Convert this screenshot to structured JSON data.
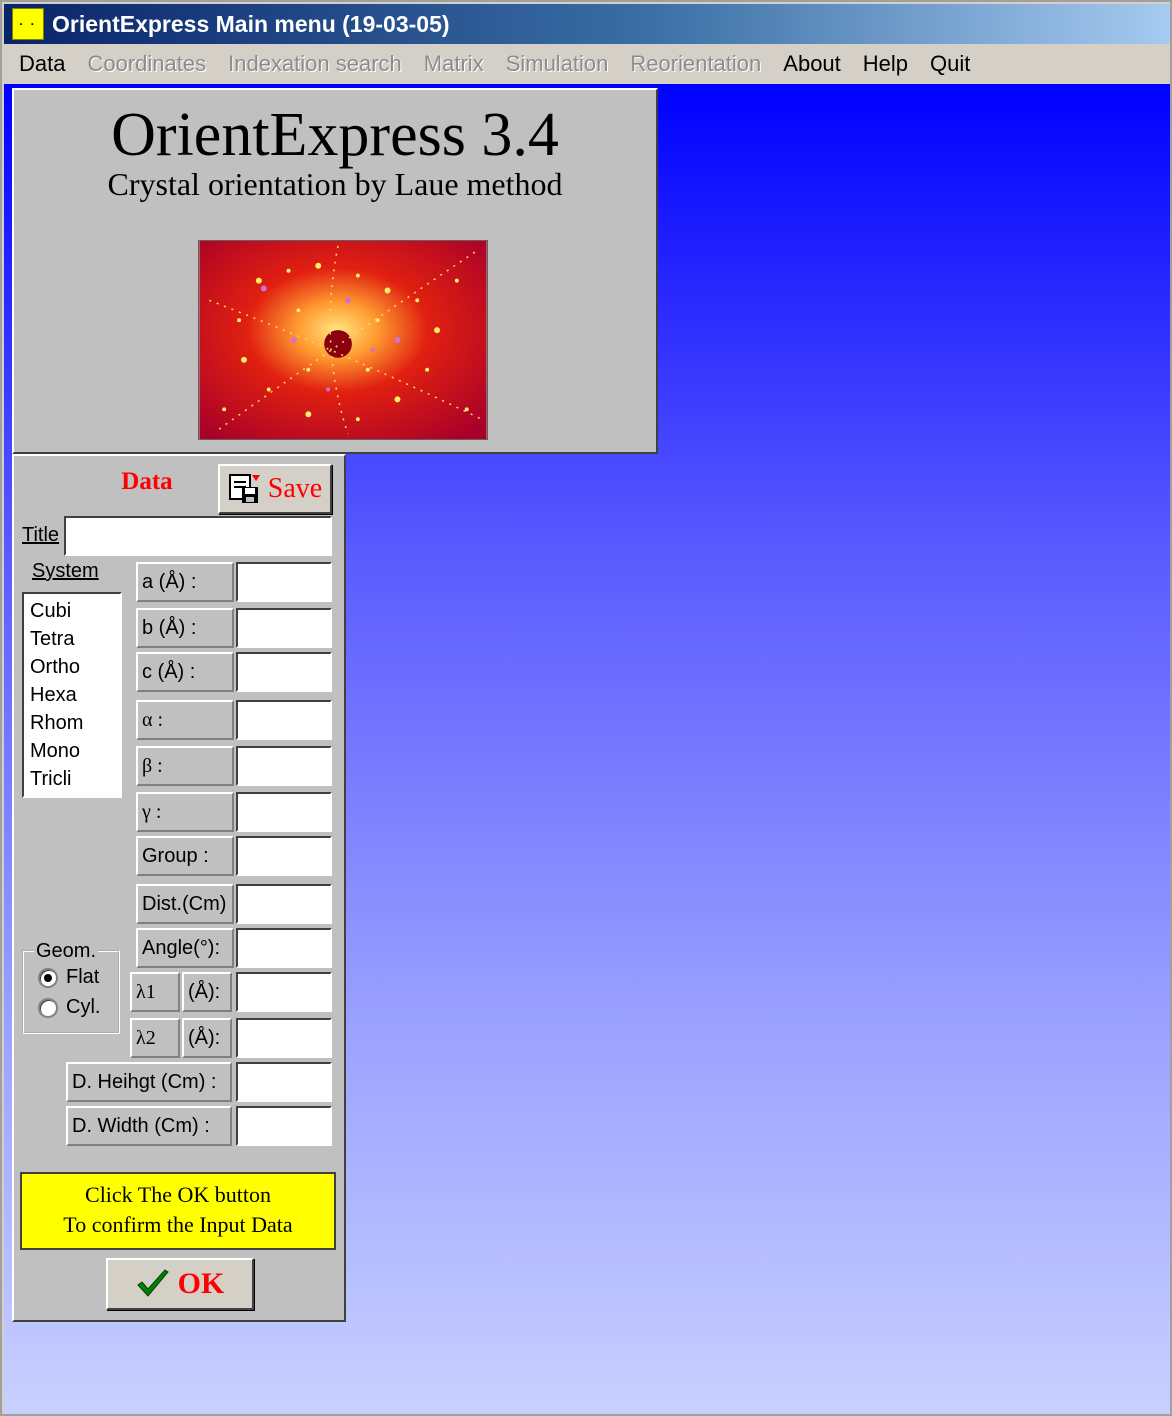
{
  "window": {
    "title": "OrientExpress Main menu (19-03-05)",
    "icon": "app-icon",
    "icon_glyph": "· ·"
  },
  "menubar": {
    "items": [
      {
        "label": "Data",
        "enabled": true
      },
      {
        "label": "Coordinates",
        "enabled": false
      },
      {
        "label": "Indexation search",
        "enabled": false
      },
      {
        "label": "Matrix",
        "enabled": false
      },
      {
        "label": "Simulation",
        "enabled": false
      },
      {
        "label": "Reorientation",
        "enabled": false
      },
      {
        "label": "About",
        "enabled": true
      },
      {
        "label": "Help",
        "enabled": true
      },
      {
        "label": "Quit",
        "enabled": true
      }
    ]
  },
  "banner": {
    "title": "OrientExpress 3.4",
    "subtitle": "Crystal orientation by Laue method",
    "image_icon": "laue-pattern-image"
  },
  "data_panel": {
    "title": "Data",
    "save_label": "Save",
    "save_icon": "save-icon",
    "title_field": {
      "label": "Title",
      "value": ""
    },
    "system": {
      "label": "System",
      "options": [
        "Cubi",
        "Tetra",
        "Ortho",
        "Hexa",
        "Rhom",
        "Mono",
        "Tricli"
      ]
    },
    "fields": {
      "a": {
        "label": "a (Å) :",
        "value": ""
      },
      "b": {
        "label": "b (Å) :",
        "value": ""
      },
      "c": {
        "label": "c (Å) :",
        "value": ""
      },
      "alpha": {
        "label": "α :",
        "value": ""
      },
      "beta": {
        "label": "β :",
        "value": ""
      },
      "gamma": {
        "label": "γ :",
        "value": ""
      },
      "group": {
        "label": "Group :",
        "value": ""
      },
      "dist": {
        "label": "Dist.(Cm)",
        "value": ""
      },
      "angle": {
        "label": "Angle(°):",
        "value": ""
      },
      "lambda1": {
        "label": "λ1",
        "unit": "(Å):",
        "value": ""
      },
      "lambda2": {
        "label": "λ2",
        "unit": "(Å):",
        "value": ""
      },
      "d_height": {
        "label": "D. Heihgt  (Cm) :",
        "value": ""
      },
      "d_width": {
        "label": "D. Width (Cm) :",
        "value": ""
      }
    },
    "geometry": {
      "label": "Geom.",
      "options": [
        {
          "label": "Flat",
          "selected": true
        },
        {
          "label": "Cyl.",
          "selected": false
        }
      ]
    },
    "hint": {
      "line1": "Click The OK button",
      "line2": "To confirm the Input Data"
    },
    "ok_label": "OK",
    "ok_icon": "checkmark-icon"
  },
  "colors": {
    "accent_red": "#ff0000",
    "hint_yellow": "#ffff00",
    "workspace_top": "#0000ff",
    "workspace_bottom": "#c8d0ff"
  }
}
